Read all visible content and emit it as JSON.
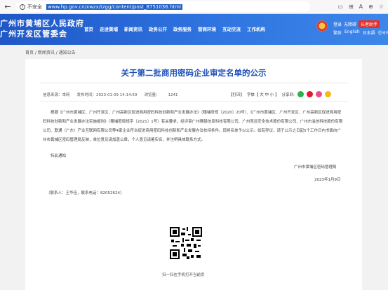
{
  "browser": {
    "insecure_label": "不安全",
    "url": "www.hp.gov.cn/xwzx/tzgg/content/post_8751036.html",
    "back_icon": "back-arrow-icon",
    "warning_icon": "warning-icon"
  },
  "site": {
    "title_line1": "广州市黄埔区人民政府",
    "title_line2": "广州开发区管委会",
    "nav": [
      "首页",
      "走进黄埔",
      "新闻资讯",
      "政务公开",
      "政务服务",
      "营商环境",
      "互动交流",
      "工作机构"
    ],
    "login": "登录",
    "accessibility": "无障碍",
    "elder_mode": "长者助手",
    "lang_simplified": "繁体",
    "lang_english": "English",
    "lang_japanese": "日本語",
    "lang_korean": "한국어"
  },
  "breadcrumb": "首页 / 新闻资讯 / 通知公告",
  "article": {
    "title": "关于第二批商用密码企业审定名单的公示",
    "source": "信息来源：本网",
    "published": "发布时间：2023-01-09 14:14:59",
    "views_label": "浏览量：",
    "views": "1241",
    "print": "【打印】",
    "font_size": "字体【 大  中  小 】",
    "share_label": "分享到:",
    "body": "根据《广州市黄埔区、广州开发区、广州高新区促进商用密码科技创新和产业发展办法》（穗埔府规〔2020〕20号）、《广州市黄埔区、广州开发区、广州高新区促进商用密码科技创新和产业发展办法实施细则》（穗埔密局规字〔2021〕1号）有关要求，经评审广州赛赫信息科技有限公司、广州竞远安全技术股份有限公司、广州市溢信科技股份有限公司、联通（广东）产业互联网有限公司等4家企业符合促进商用密码科技创新和产业发展办法扶持条件。现将名单予以公示。如有异议，请于公示之日起5个工作日内书面向广州市黄埔区密码管理局反映，单位意见请加盖公章，个人意见请署实名，并注明具体联系方式。",
    "closing": "特此通知",
    "signature": "广州市黄埔区密码管理局",
    "date": "2023年1月9日",
    "contact": "（联系人：王华佳，联系电话：82052624）",
    "qr_caption": "扫一扫在手机打开当前页"
  },
  "colors": {
    "header_blue": "#1f57c7",
    "title_blue": "#1c4fb8",
    "elder_red": "#e52f2a"
  }
}
